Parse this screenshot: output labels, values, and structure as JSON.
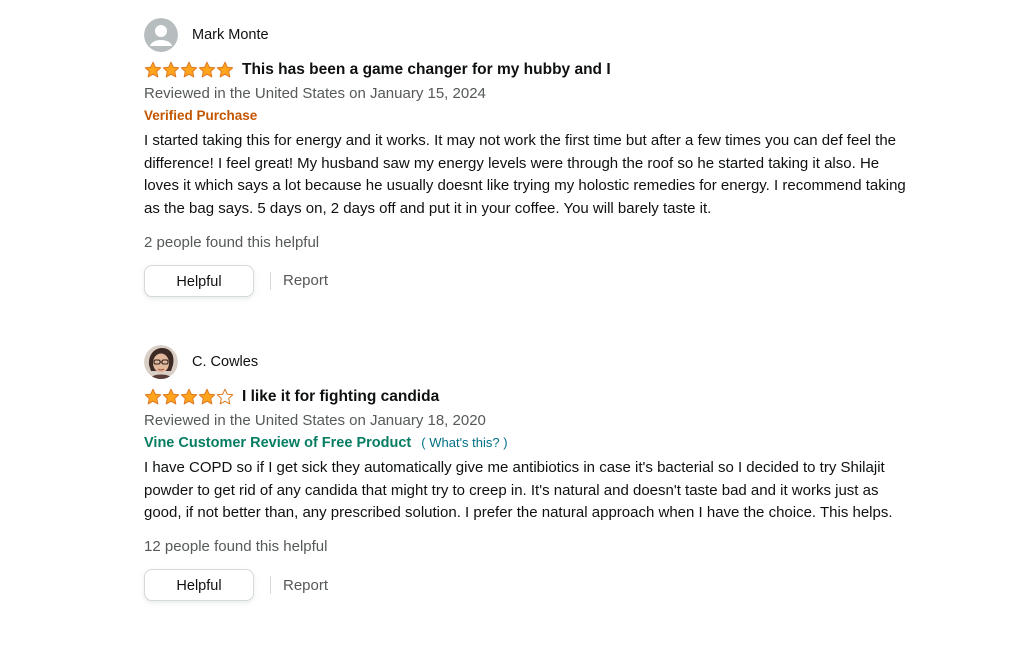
{
  "reviews": [
    {
      "reviewer": "Mark Monte",
      "rating": 5,
      "title": "This has been a game changer for my hubby and I",
      "date": "Reviewed in the United States on January 15, 2024",
      "badge": "Verified Purchase",
      "body": "I started taking this for energy and it works. It may not work the first time but after a few times you can def feel the difference! I feel great! My husband saw my energy levels were through the roof so he started taking it also. He loves it which says a lot because he usually doesnt like trying my holostic remedies for energy. I recommend taking as the bag says. 5 days on, 2 days off and put it in your coffee. You will barely taste it.",
      "helpful_count": "2 people found this helpful",
      "helpful_label": "Helpful",
      "report_label": "Report"
    },
    {
      "reviewer": "C. Cowles",
      "rating": 4,
      "title": "I like it for fighting candida",
      "date": "Reviewed in the United States on January 18, 2020",
      "badge": "Vine Customer Review of Free Product",
      "badge_link": "( What's this? )",
      "body": "I have COPD so if I get sick they automatically give me antibiotics in case it's bacterial so I decided to try Shilajit powder to get rid of any candida that might try to creep in. It's natural and doesn't taste bad and it works just as good, if not better than, any prescribed solution. I prefer the natural approach when I have the choice. This helps.",
      "helpful_count": "12 people found this helpful",
      "helpful_label": "Helpful",
      "report_label": "Report"
    }
  ],
  "colors": {
    "star": "#ffa41c",
    "verified": "#c45500",
    "vine": "#067d62",
    "link": "#007185",
    "secondary_text": "#565959"
  }
}
